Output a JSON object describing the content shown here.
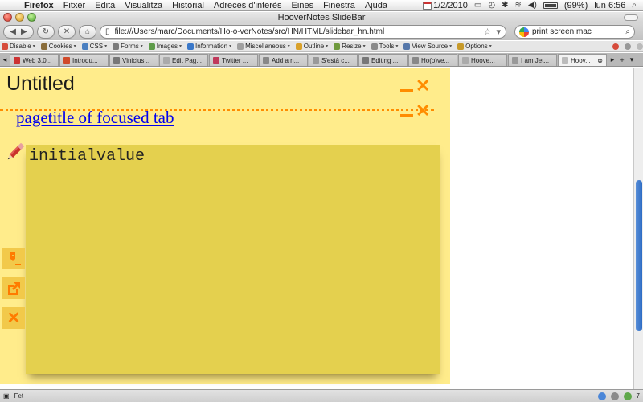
{
  "menubar": {
    "app_name": "Firefox",
    "menus": [
      "Fitxer",
      "Edita",
      "Visualitza",
      "Historial",
      "Adreces d'interès",
      "Eines",
      "Finestra",
      "Ajuda"
    ],
    "date": "1/2/2010",
    "battery": "(99%)",
    "clock": "lun 6:56"
  },
  "window": {
    "title": "HooverNotes SlideBar"
  },
  "navbar": {
    "url": "file:///Users/marc/Documents/Ho-o-verNotes/src/HN/HTML/slidebar_hn.html",
    "search_value": "print screen mac"
  },
  "devbar": {
    "items": [
      {
        "label": "Disable",
        "color": "#d64b3b"
      },
      {
        "label": "Cookies",
        "color": "#8a6d3b"
      },
      {
        "label": "CSS",
        "color": "#4a7fc1"
      },
      {
        "label": "Forms",
        "color": "#7a7a7a"
      },
      {
        "label": "Images",
        "color": "#5e9b4a"
      },
      {
        "label": "Information",
        "color": "#3a78c9"
      },
      {
        "label": "Miscellaneous",
        "color": "#a0a0a0"
      },
      {
        "label": "Outline",
        "color": "#d9a12b"
      },
      {
        "label": "Resize",
        "color": "#6f9a3d"
      },
      {
        "label": "Tools",
        "color": "#8a8a8a"
      },
      {
        "label": "View Source",
        "color": "#5577aa"
      },
      {
        "label": "Options",
        "color": "#c79a2a"
      }
    ]
  },
  "tabs": [
    {
      "label": "Web 3.0...",
      "color": "#c33"
    },
    {
      "label": "Introdu...",
      "color": "#d04a2a"
    },
    {
      "label": "Vinicius...",
      "color": "#777"
    },
    {
      "label": "Edit Pag...",
      "color": "#aaa"
    },
    {
      "label": "Twitter ...",
      "color": "#c0395b"
    },
    {
      "label": "Add a n...",
      "color": "#888"
    },
    {
      "label": "S'està c...",
      "color": "#999"
    },
    {
      "label": "Editing ...",
      "color": "#777"
    },
    {
      "label": "Ho(o)ve...",
      "color": "#888"
    },
    {
      "label": "Hoove...",
      "color": "#aaa"
    },
    {
      "label": "I am Jet...",
      "color": "#999"
    },
    {
      "label": "Hoov...",
      "color": "#bbb",
      "active": true
    }
  ],
  "slidebar": {
    "title": "Untitled",
    "link": "pagetitle of focused tab",
    "note_value": "initialvalue"
  },
  "statusbar": {
    "text": "Fet",
    "count": "7"
  },
  "colors": {
    "slidebar_bg": "#ffec8b",
    "note_bg": "#e4d04e",
    "accent": "#ff8c00",
    "link": "#0000ee"
  }
}
